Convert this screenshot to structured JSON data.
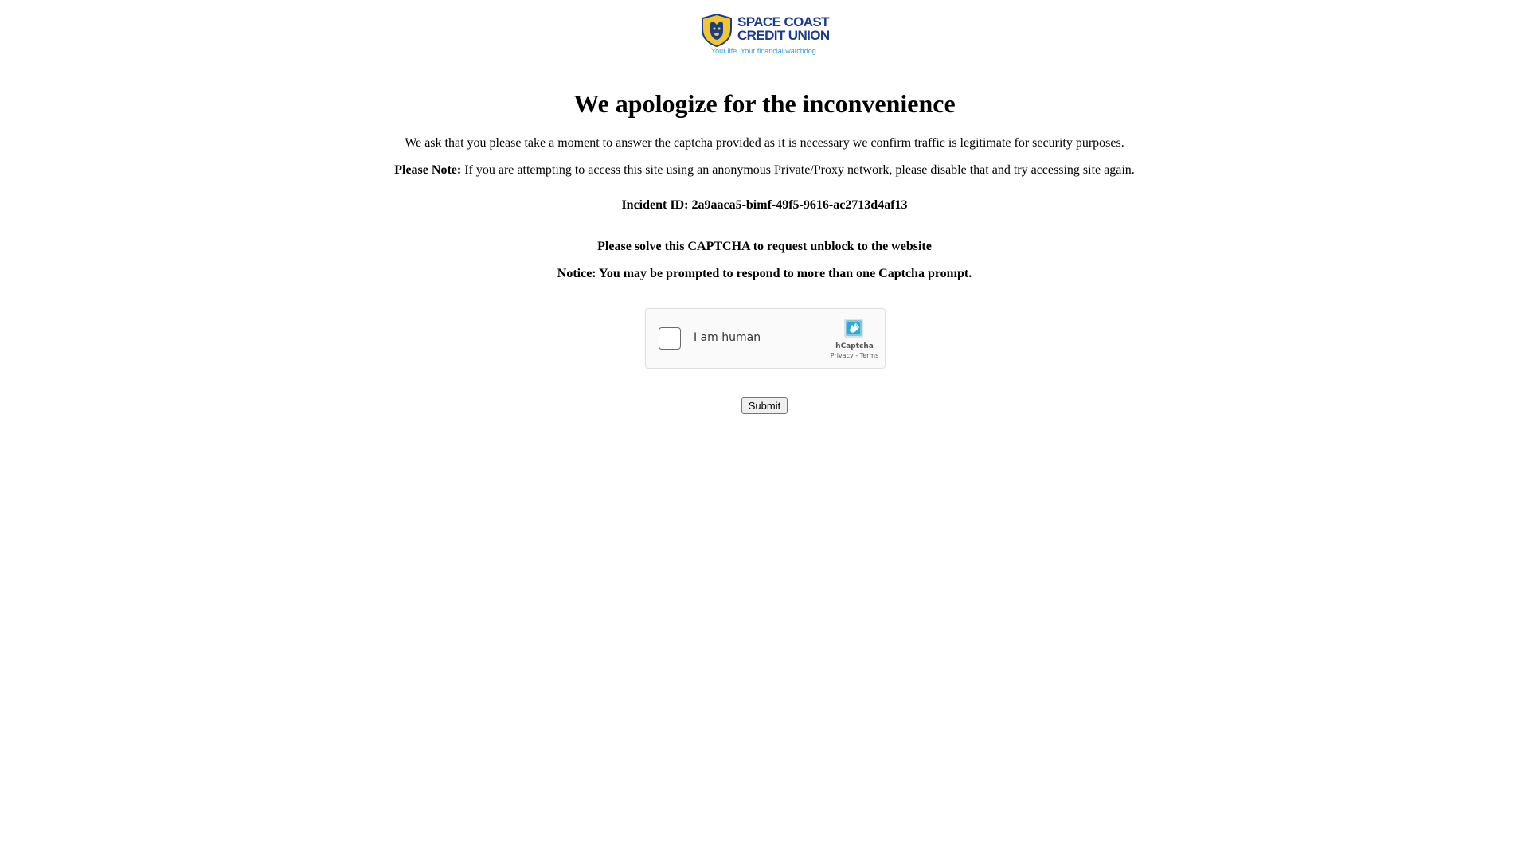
{
  "logo": {
    "line1": "SPACE COAST",
    "line2": "CREDIT UNION",
    "tagline": "Your life. Your financial watchdog.",
    "colors": {
      "navy": "#1b3b8c",
      "gold": "#f2c62e",
      "tagline_blue": "#2f9fd8"
    }
  },
  "title": "We apologize for the inconvenience",
  "message": "We ask that you please take a moment to answer the captcha provided as it is necessary we confirm traffic is legitimate for security purposes.",
  "note": {
    "label": "Please Note:",
    "text": " If you are attempting to access this site using an anonymous Private/Proxy network, please disable that and try accessing site again."
  },
  "incident": "Incident ID: 2a9aaca5-bimf-49f5-9616-ac2713d4af13",
  "solve_prompt": "Please solve this CAPTCHA to request unblock to the website",
  "notice": "Notice: You may be prompted to respond to more than one Captcha prompt.",
  "captcha": {
    "label": "I am human",
    "brand": "hCaptcha",
    "privacy": "Privacy",
    "separator": " - ",
    "terms": "Terms",
    "icon": "hcaptcha-logo-icon",
    "accent": "#0074bf"
  },
  "submit_label": "Submit"
}
